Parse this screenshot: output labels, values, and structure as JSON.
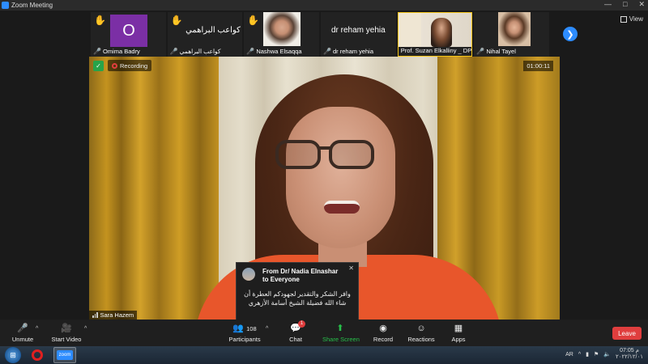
{
  "window": {
    "title": "Zoom Meeting"
  },
  "view_label": "View",
  "thumbnails": [
    {
      "name": "Omima Badry",
      "initial": "O",
      "hand": true
    },
    {
      "name": "كواعب البراهمي",
      "display_name": "كواعب البراهمي",
      "hand": true
    },
    {
      "name": "Nashwa Elsaqqa",
      "hand": true
    },
    {
      "name": "dr reham yehia",
      "display_name": "dr reham yehia",
      "hand": false
    },
    {
      "name": "Prof. Suzan Elkalliny _ DP",
      "hand": false
    },
    {
      "name": "Nihal Tayel",
      "hand": false
    }
  ],
  "main_video": {
    "recording_label": "Recording",
    "timer": "01:00:11",
    "speaker_name": "Sara Hazem"
  },
  "chat": {
    "title": "From Dr/ Nadia Elnashar to Everyone",
    "message": "وافر الشكر والتقدير لجهودكم العطرة أن شاء الله فضيلة الشيخ أسامة الأزهري"
  },
  "toolbar": {
    "unmute": "Unmute",
    "start_video": "Start Video",
    "participants": "Participants",
    "participants_count": "108",
    "chat": "Chat",
    "chat_badge": "1",
    "share_screen": "Share Screen",
    "record": "Record",
    "reactions": "Reactions",
    "apps": "Apps",
    "leave": "Leave"
  },
  "taskbar": {
    "zoom_label": "zoom",
    "language": "AR",
    "time": "07:05 م",
    "date": "٢٠٢٢/١٢/٠١"
  },
  "icons": {
    "hand": "raised-hand-icon",
    "mic_off": "mic-off-icon",
    "video_off": "video-off-icon"
  },
  "colors": {
    "accent": "#2d8cff",
    "leave": "#e03e3e",
    "share": "#27c04a",
    "hand": "#f5c518",
    "avatar_bg": "#7b2fa5"
  }
}
